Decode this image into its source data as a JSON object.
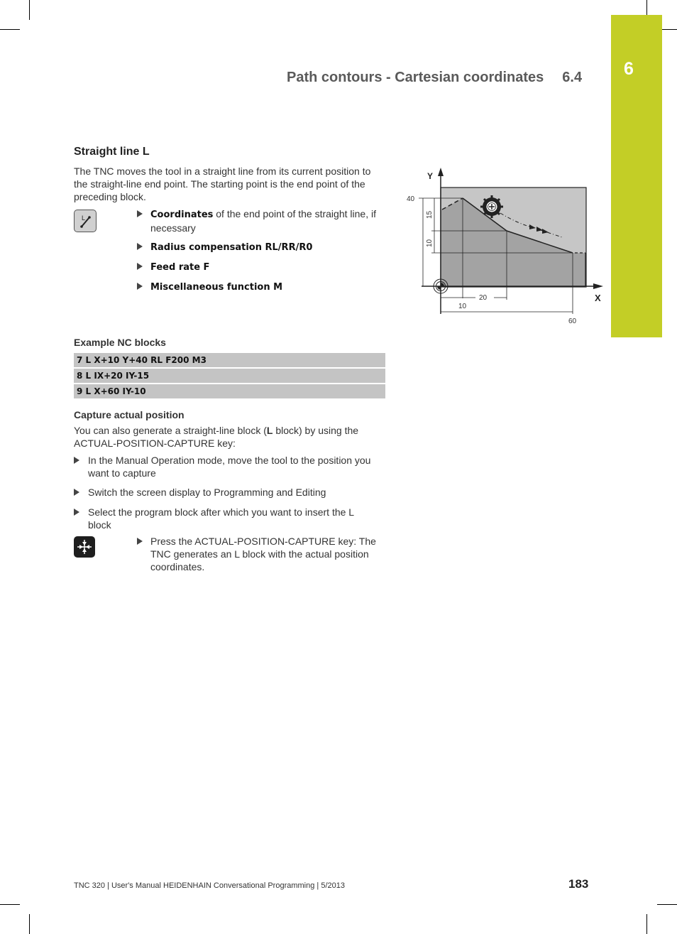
{
  "header": {
    "chapter_number": "6",
    "section_title": "Path contours - Cartesian coordinates",
    "section_number": "6.4",
    "tab_color": "#c3ce26"
  },
  "straight_line": {
    "title": "Straight line L",
    "intro": "The TNC moves the tool in a straight line from its current position to the straight-line end point. The starting point is the end point of the preceding block.",
    "key_icon": "line-L-key-icon",
    "items": [
      {
        "bold": "Coordinates",
        "rest": " of the end point of the straight line, if necessary"
      },
      {
        "bold": "Radius compensation RL/RR/R0",
        "rest": ""
      },
      {
        "bold": "Feed rate F",
        "rest": ""
      },
      {
        "bold": "Miscellaneous function M",
        "rest": ""
      }
    ]
  },
  "diagram": {
    "axis_x_label": "X",
    "axis_y_label": "Y",
    "labels": {
      "y40": "40",
      "dim15": "15",
      "dim10": "10",
      "x10": "10",
      "dx20": "20",
      "x60": "60"
    }
  },
  "example": {
    "title": "Example NC blocks",
    "blocks": [
      "7 L X+10 Y+40 RL F200 M3",
      "8 L IX+20 IY-15",
      "9 L X+60 IY-10"
    ]
  },
  "capture": {
    "title": "Capture actual position",
    "intro_pre": "You can also generate a straight-line block (",
    "intro_bold": "L",
    "intro_post": " block) by using the ACTUAL-POSITION-CAPTURE key:",
    "steps": [
      "In the Manual Operation mode, move the tool to the position you want to capture",
      "Switch the screen display to Programming and Editing",
      "Select the program block after which you want to insert the L block"
    ],
    "key_icon": "actual-position-capture-key-icon",
    "key_step": "Press the ACTUAL-POSITION-CAPTURE key: The TNC generates an L block with the actual position coordinates."
  },
  "footer": {
    "text": "TNC 320 | User's Manual HEIDENHAIN Conversational Programming | 5/2013",
    "page_number": "183"
  }
}
